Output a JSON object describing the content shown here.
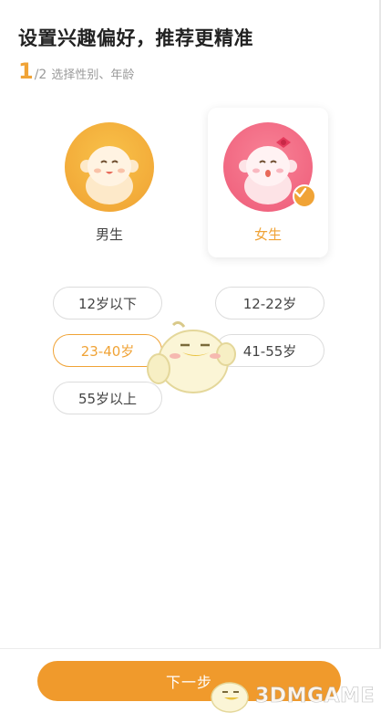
{
  "header": {
    "title": "设置兴趣偏好，推荐更精准",
    "step_current": "1",
    "step_total": "/2",
    "step_desc": "选择性别、年龄"
  },
  "gender": {
    "options": [
      {
        "label": "男生",
        "selected": false
      },
      {
        "label": "女生",
        "selected": true
      }
    ]
  },
  "age": {
    "options": [
      {
        "label": "12岁以下",
        "selected": false
      },
      {
        "label": "12-22岁",
        "selected": false
      },
      {
        "label": "23-40岁",
        "selected": true
      },
      {
        "label": "41-55岁",
        "selected": false
      },
      {
        "label": "55岁以上",
        "selected": false
      }
    ]
  },
  "footer": {
    "next_label": "下一步"
  },
  "watermark": {
    "text": "3DMGAME"
  },
  "colors": {
    "accent": "#f0a336",
    "button": "#f09a2c",
    "male_avatar": "#f5b13c",
    "female_avatar": "#f2687f"
  }
}
